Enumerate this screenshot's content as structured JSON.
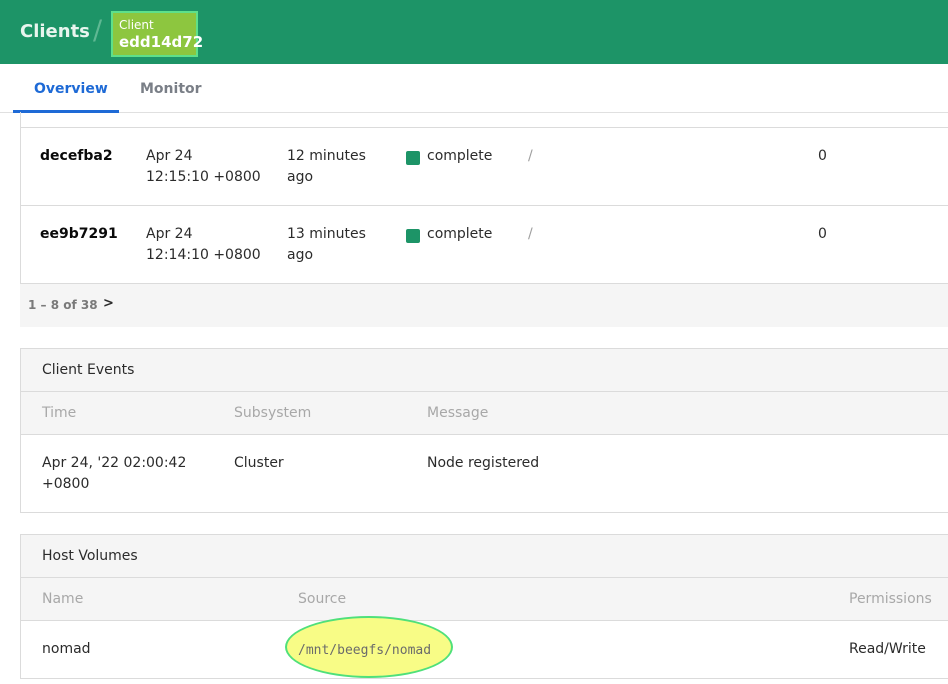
{
  "header": {
    "title": "Clients",
    "separator": "/",
    "badge_label": "Client",
    "badge_id": "edd14d72"
  },
  "tabs": [
    {
      "label": "Overview",
      "active": true
    },
    {
      "label": "Monitor",
      "active": false
    }
  ],
  "allocations": {
    "rows": [
      {
        "id": "decefba2",
        "created_date": "Apr 24",
        "created_time": "12:15:10 +0800",
        "modified_a": "12 minutes",
        "modified_b": "ago",
        "status": "complete",
        "slash": "/",
        "count": "0"
      },
      {
        "id": "ee9b7291",
        "created_date": "Apr 24",
        "created_time": "12:14:10 +0800",
        "modified_a": "13 minutes",
        "modified_b": "ago",
        "status": "complete",
        "slash": "/",
        "count": "0"
      }
    ],
    "pager_text": "1 – 8 of 38",
    "pager_next": ">"
  },
  "client_events": {
    "title": "Client Events",
    "columns": [
      "Time",
      "Subsystem",
      "Message"
    ],
    "rows": [
      {
        "time_a": "Apr 24, '22 02:00:42",
        "time_b": "+0800",
        "subsystem": "Cluster",
        "message": "Node registered"
      }
    ]
  },
  "host_volumes": {
    "title": "Host Volumes",
    "columns": [
      "Name",
      "Source",
      "Permissions"
    ],
    "rows": [
      {
        "name": "nomad",
        "source": "/mnt/beegfs/nomad",
        "permissions": "Read/Write"
      }
    ]
  },
  "colors": {
    "header_bg": "#1d9467",
    "badge_bg": "#8dc63f",
    "active_tab": "#1e6ad6",
    "status_complete": "#1d9467",
    "highlight": "#f8fc86"
  }
}
